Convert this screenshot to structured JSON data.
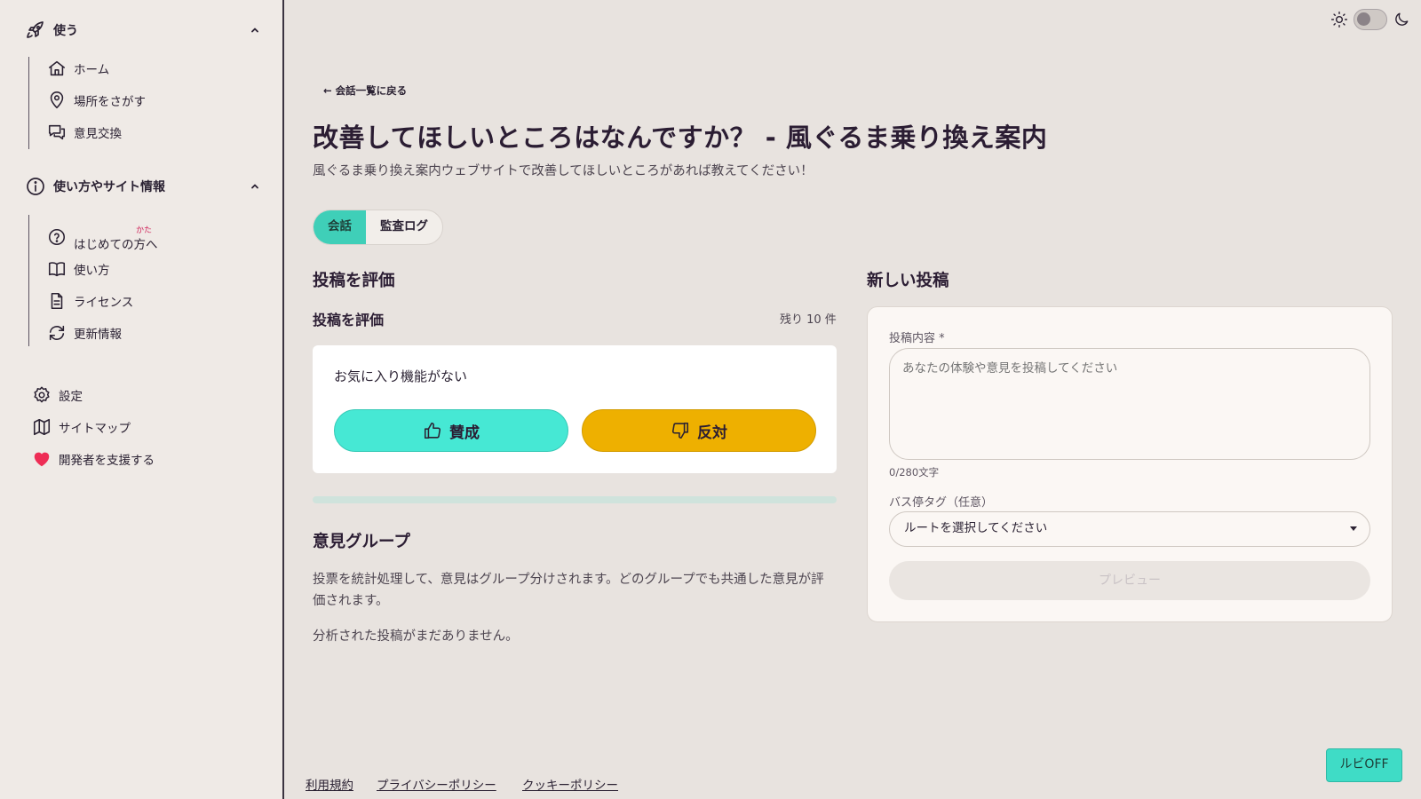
{
  "sidebar": {
    "use_section": {
      "title": "使う",
      "items": [
        {
          "label": "ホーム",
          "icon": "home-icon"
        },
        {
          "label": "場所をさがす",
          "icon": "map-pin-icon"
        },
        {
          "label": "意見交換",
          "icon": "chat-bubbles-icon"
        }
      ]
    },
    "info_section": {
      "title": "使い方やサイト情報",
      "items": [
        {
          "label": "はじめての方へ",
          "ruby": "かた",
          "icon": "question-circle-icon"
        },
        {
          "label": "使い方",
          "icon": "book-icon"
        },
        {
          "label": "ライセンス",
          "icon": "document-icon"
        },
        {
          "label": "更新情報",
          "icon": "refresh-icon"
        }
      ]
    },
    "bottom_items": [
      {
        "label": "設定",
        "icon": "gear-icon"
      },
      {
        "label": "サイトマップ",
        "icon": "map-icon"
      },
      {
        "label": "開発者を支援する",
        "icon": "heart-icon"
      }
    ]
  },
  "main": {
    "back_link": "← 会話一覧に戻る",
    "title": "改善してほしいところはなんですか？ - 風ぐるま乗り換え案内",
    "description": "風ぐるま乗り換え案内ウェブサイトで改善してほしいところがあれば教えてください！",
    "tabs": [
      {
        "label": "会話",
        "active": true
      },
      {
        "label": "監査ログ",
        "active": false
      }
    ],
    "evaluate": {
      "heading": "投稿を評価",
      "subheading": "投稿を評価",
      "remaining": "残り 10 件",
      "statement": "お気に入り機能がない",
      "agree_label": "賛成",
      "disagree_label": "反対",
      "progress": 0
    },
    "opinion_groups": {
      "heading": "意見グループ",
      "description": "投票を統計処理して、意見はグループ分けされます。どのグループでも共通した意見が評価されます。",
      "empty_text": "分析された投稿がまだありません。"
    },
    "new_post": {
      "heading": "新しい投稿",
      "content_label": "投稿内容 *",
      "content_placeholder": "あなたの体験や意見を投稿してください",
      "counter": "0/280文字",
      "tag_label": "バス停タグ（任意）",
      "tag_value": "ルートを選択してください",
      "preview_button": "プレビュー"
    }
  },
  "footer": {
    "links": [
      "利用規約",
      "プライバシーポリシー",
      "クッキーポリシー"
    ]
  },
  "ruby_toggle": "ルビOFF",
  "colors": {
    "accent": "#3fcfb8",
    "agree": "#46e8d4",
    "disagree": "#eeb000",
    "background": "#e8e3df"
  }
}
